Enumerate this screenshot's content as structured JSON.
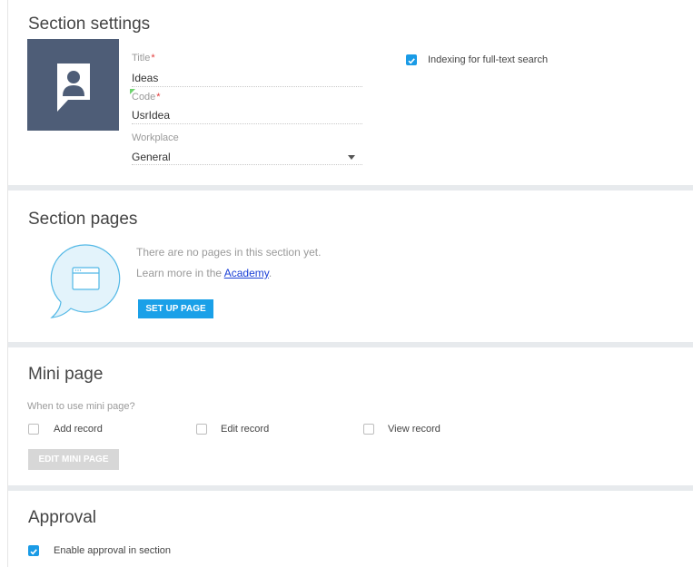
{
  "settings": {
    "title": "Section settings",
    "title_label": "Title",
    "title_value": "Ideas",
    "code_label": "Code",
    "code_value": "UsrIdea",
    "workplace_label": "Workplace",
    "workplace_value": "General",
    "required_mark": "*",
    "indexing_label": "Indexing for full-text search",
    "indexing_checked": true
  },
  "pages": {
    "title": "Section pages",
    "empty_text": "There are no pages in this section yet.",
    "learn_prefix": "Learn more in the ",
    "academy_link": "Academy",
    "learn_suffix": ".",
    "setup_button": "SET UP PAGE"
  },
  "mini": {
    "title": "Mini page",
    "prompt": "When to use mini page?",
    "options": [
      {
        "label": "Add record",
        "checked": false
      },
      {
        "label": "Edit record",
        "checked": false
      },
      {
        "label": "View record",
        "checked": false
      }
    ],
    "edit_button": "EDIT MINI PAGE"
  },
  "approval": {
    "title": "Approval",
    "enable_label": "Enable approval in section",
    "enable_checked": true
  },
  "colors": {
    "accent": "#1aa0e8",
    "icon_bg": "#4e5d77",
    "required": "#e23b3b",
    "link": "#1a3fd6"
  }
}
